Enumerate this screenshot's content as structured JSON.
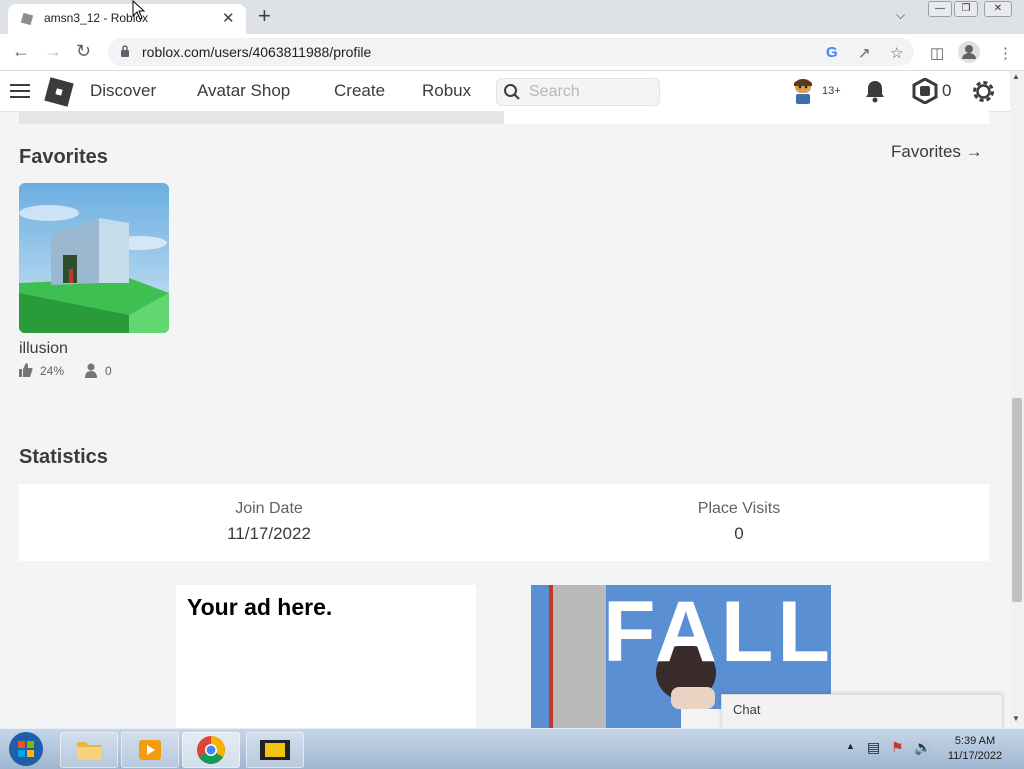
{
  "browser": {
    "tab_title": "amsn3_12 - Roblox",
    "url": "roblox.com/users/4063811988/profile",
    "new_tab": "+",
    "tab_close": "✕"
  },
  "header": {
    "nav": [
      "Discover",
      "Avatar Shop",
      "Create",
      "Robux"
    ],
    "search_placeholder": "Search",
    "age_badge": "13+",
    "robux_count": "0"
  },
  "favorites": {
    "title": "Favorites",
    "link": "Favorites →",
    "games": [
      {
        "name": "illusion",
        "rating": "24%",
        "players": "0"
      }
    ]
  },
  "statistics": {
    "title": "Statistics",
    "items": [
      {
        "label": "Join Date",
        "value": "11/17/2022"
      },
      {
        "label": "Place Visits",
        "value": "0"
      }
    ]
  },
  "ads": {
    "left_text": "Your ad here.",
    "right_text": "FALL"
  },
  "chat": {
    "label": "Chat"
  },
  "taskbar": {
    "time": "5:39 AM",
    "date": "11/17/2022"
  }
}
